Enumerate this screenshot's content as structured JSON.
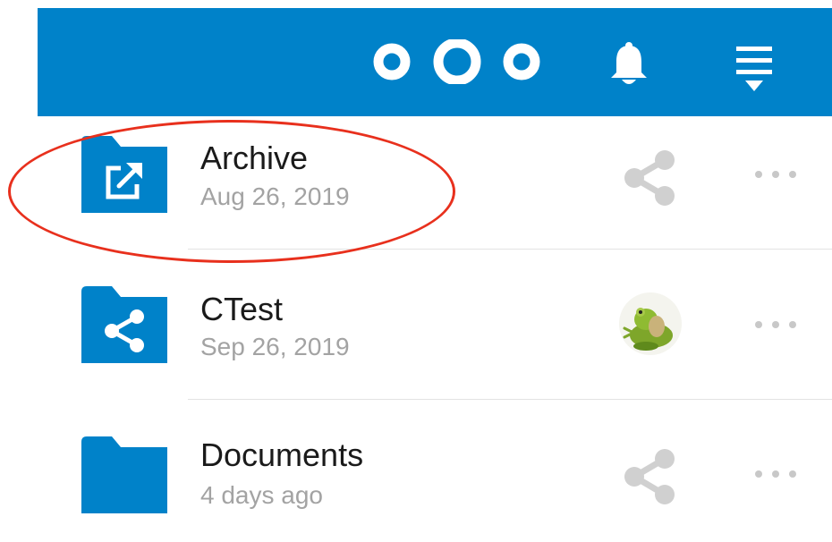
{
  "app": {
    "logo_icon": "nextcloud-logo",
    "header_color": "#0082c9"
  },
  "header": {
    "notifications_icon": "bell-icon",
    "menu_icon": "menu-dropdown-icon"
  },
  "files": [
    {
      "name": "Archive",
      "date": "Aug 26, 2019",
      "icon": "folder-external-icon",
      "share_state": "not-shared",
      "highlighted": true
    },
    {
      "name": "CTest",
      "date": "Sep 26, 2019",
      "icon": "folder-shared-icon",
      "share_state": "shared-with-user-avatar"
    },
    {
      "name": "Documents",
      "date": "4 days ago",
      "icon": "folder-icon",
      "share_state": "not-shared"
    }
  ],
  "annotation": {
    "color": "#e8301d"
  }
}
